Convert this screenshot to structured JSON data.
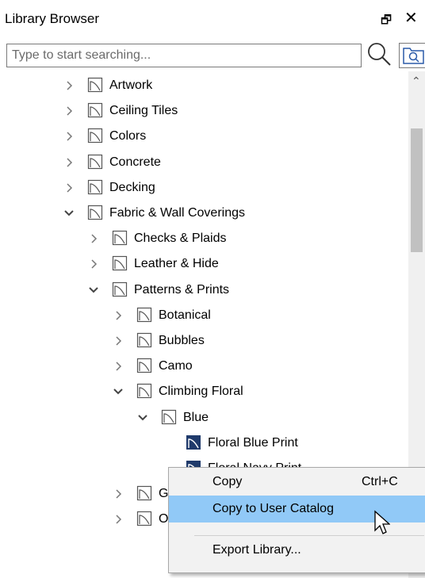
{
  "panel": {
    "title": "Library Browser",
    "float_icon": "restore-window-icon",
    "close_icon": "close-icon"
  },
  "search": {
    "placeholder": "Type to start searching...",
    "value": ""
  },
  "tree": {
    "items": [
      {
        "label": "Artwork",
        "expander": ">"
      },
      {
        "label": "Ceiling Tiles",
        "expander": ">"
      },
      {
        "label": "Colors",
        "expander": ">"
      },
      {
        "label": "Concrete",
        "expander": ">"
      },
      {
        "label": "Decking",
        "expander": ">"
      },
      {
        "label": "Fabric & Wall Coverings",
        "expander": "v"
      },
      {
        "label": "Checks & Plaids",
        "expander": ">"
      },
      {
        "label": "Leather & Hide",
        "expander": ">"
      },
      {
        "label": "Patterns & Prints",
        "expander": "v"
      },
      {
        "label": "Botanical",
        "expander": ">"
      },
      {
        "label": "Bubbles",
        "expander": ">"
      },
      {
        "label": "Camo",
        "expander": ">"
      },
      {
        "label": "Climbing Floral",
        "expander": "v"
      },
      {
        "label": "Blue",
        "expander": "v"
      },
      {
        "label": "Floral Blue Print",
        "expander": ""
      },
      {
        "label": "Floral Navy Print",
        "expander": ""
      },
      {
        "label": "Green",
        "expander": ">"
      },
      {
        "label": "Orange",
        "expander": ">"
      }
    ]
  },
  "context_menu": {
    "items": [
      {
        "label": "Copy",
        "shortcut": "Ctrl+C"
      },
      {
        "label": "Copy to User Catalog",
        "shortcut": ""
      },
      {
        "label": "Export Library...",
        "shortcut": ""
      }
    ],
    "highlighted_index": 1
  },
  "colors": {
    "menu_highlight": "#91c9f7",
    "icon_navy": "#1f3a6b"
  }
}
